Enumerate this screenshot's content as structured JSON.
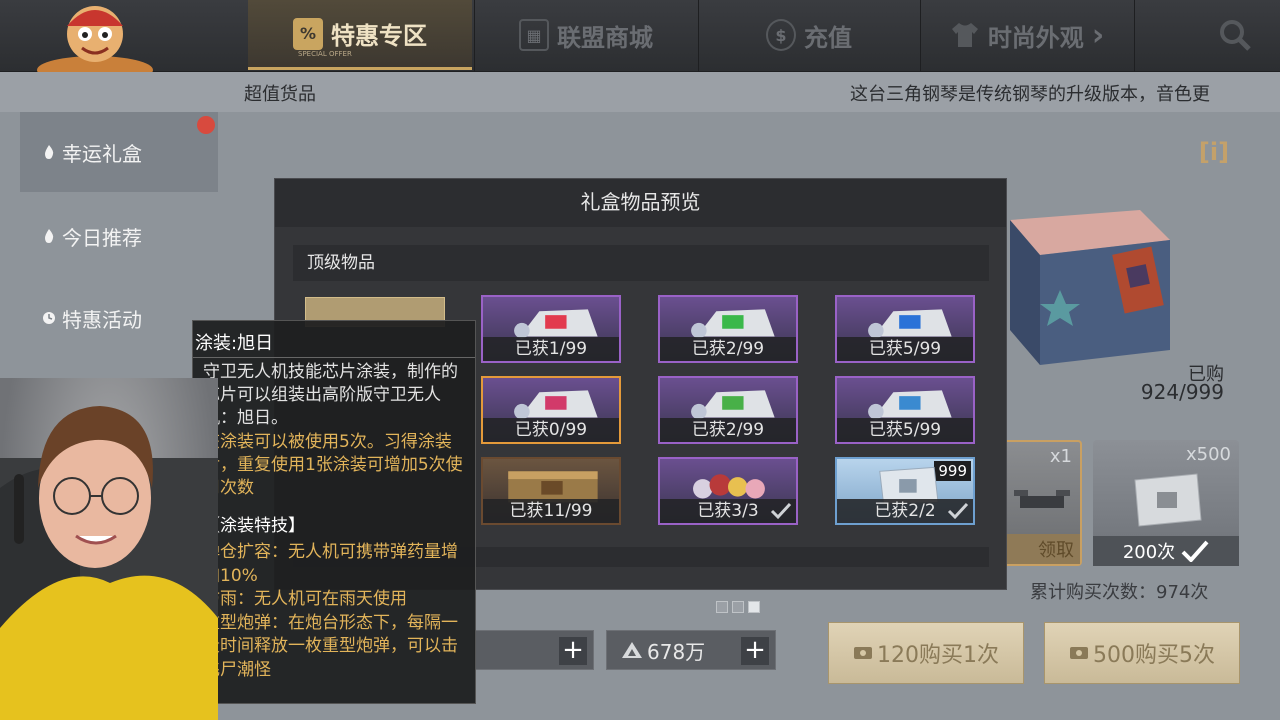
{
  "nav": {
    "tabs": [
      {
        "label": "特惠专区",
        "sub": "SPECIAL OFFER",
        "icon": "shopping-bag-icon",
        "active": true
      },
      {
        "label": "联盟商城",
        "icon": "league-shop-icon",
        "active": false
      },
      {
        "label": "充值",
        "icon": "coin-icon",
        "active": false
      },
      {
        "label": "时尚外观",
        "icon": "shirt-icon",
        "active": false
      }
    ],
    "more_arrow": "›"
  },
  "subbar": {
    "left_text": "超值货品",
    "marquee": "这台三角钢琴是传统钢琴的升级版本，音色更"
  },
  "sidebar": {
    "items": [
      {
        "label": "幸运礼盒"
      },
      {
        "label": "今日推荐"
      },
      {
        "label": "特惠活动"
      }
    ]
  },
  "shop": {
    "info_label": "i",
    "bought_label": "已购",
    "bought_value": "924/999",
    "rewards": [
      {
        "qty": "x1",
        "foot": "领取"
      },
      {
        "qty": "x500",
        "foot": "200次"
      }
    ],
    "total_buys": "累计购买次数：974次",
    "buy_one": "120购买1次",
    "buy_five": "500购买5次"
  },
  "counters": {
    "first_plus": "+",
    "second_value": "678万",
    "second_plus": "+"
  },
  "modal": {
    "title": "礼盒物品预览",
    "section": "顶级物品",
    "items": [
      {
        "label": "已获1/99",
        "type": "chip",
        "chip_color": "#e23a4e"
      },
      {
        "label": "已获2/99",
        "type": "chip",
        "chip_color": "#3ab84a"
      },
      {
        "label": "已获5/99",
        "type": "chip",
        "chip_color": "#2a72d8"
      },
      {
        "label": "已获0/99",
        "type": "chip",
        "chip_color": "#d23a6a"
      },
      {
        "label": "已获2/99",
        "type": "chip",
        "chip_color": "#48b048"
      },
      {
        "label": "已获5/99",
        "type": "chip",
        "chip_color": "#3a8ad0"
      },
      {
        "label": "已获11/99",
        "type": "crate"
      },
      {
        "label": "已获3/3",
        "type": "balloons"
      },
      {
        "label": "已获2/2",
        "type": "pack",
        "badge": "999"
      }
    ]
  },
  "tooltip": {
    "title": "涂装:旭日",
    "desc": "守卫无人机技能芯片涂装，制作的芯片可以组装出高阶版守卫无人机：旭日。",
    "usage": "该涂装可以被使用5次。习得涂装后，重复使用1张涂装可增加5次使用次数",
    "skill_title": "【涂装特技】",
    "skills": [
      "弹仓扩容：无人机可携带弹药量增加10%",
      "防雨：无人机可在雨天使用",
      "重型炮弹：在炮台形态下，每隔一段时间释放一枚重型炮弹，可以击飞尸潮怪"
    ]
  },
  "colors": {
    "accent_gold": "#c9a560",
    "item_purple_border": "#9a62c7",
    "selected_border": "#e49a3a",
    "skill_text": "#e2b45a"
  }
}
